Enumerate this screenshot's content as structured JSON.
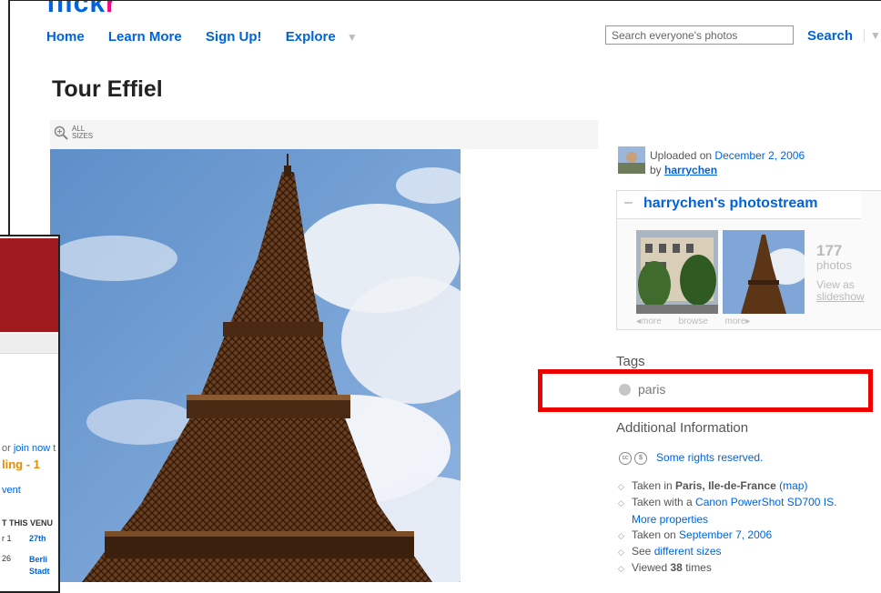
{
  "header": {
    "logo": "flickr",
    "nav": [
      "Home",
      "Learn More",
      "Sign Up!",
      "Explore"
    ],
    "search_placeholder": "Search everyone's photos",
    "search_button": "Search"
  },
  "photo": {
    "title": "Tour Effiel",
    "all_sizes_label": [
      "ALL",
      "SIZES"
    ],
    "image_desc": "Eiffel Tower against a blue sky with white clouds"
  },
  "sidebar": {
    "uploaded_prefix": "Uploaded on",
    "uploaded_date": "December 2, 2006",
    "by_prefix": "by",
    "uploader": "harrychen",
    "photostream": {
      "toggle": "–",
      "title": "harrychen's photostream",
      "count": "177",
      "count_label": "photos",
      "view_as": "View as",
      "slideshow": "slideshow",
      "nav": [
        "◂more",
        "browse",
        "more▸"
      ]
    },
    "tags_heading": "Tags",
    "tags": [
      "paris"
    ],
    "additional_heading": "Additional Information",
    "rights": "Some rights reserved.",
    "info": {
      "taken_in_prefix": "Taken in",
      "taken_in_place": "Paris, Ile-de-France",
      "map_link": "(map)",
      "taken_with_prefix": "Taken with a",
      "camera": "Canon PowerShot SD700 IS.",
      "more_properties": "More properties",
      "taken_on_prefix": "Taken on",
      "taken_on_date": "September 7, 2006",
      "see_prefix": "See",
      "different_sizes": "different sizes",
      "viewed_prefix": "Viewed",
      "viewed_count": "38",
      "viewed_suffix": "times"
    }
  },
  "overlay": {
    "join_text": "or",
    "join_link": "join now",
    "join_trail": "t",
    "ding_text": "ling - 1",
    "event_text": "vent",
    "venue_heading": "T THIS VENU",
    "row1_left": "r 1",
    "row1_right": "27th",
    "row2_left": "26",
    "row2_right": [
      "Berli",
      "Stadt"
    ]
  },
  "colors": {
    "link": "#0063dc",
    "highlight": "#ee0000",
    "overlay_header": "#9e1a1e"
  }
}
